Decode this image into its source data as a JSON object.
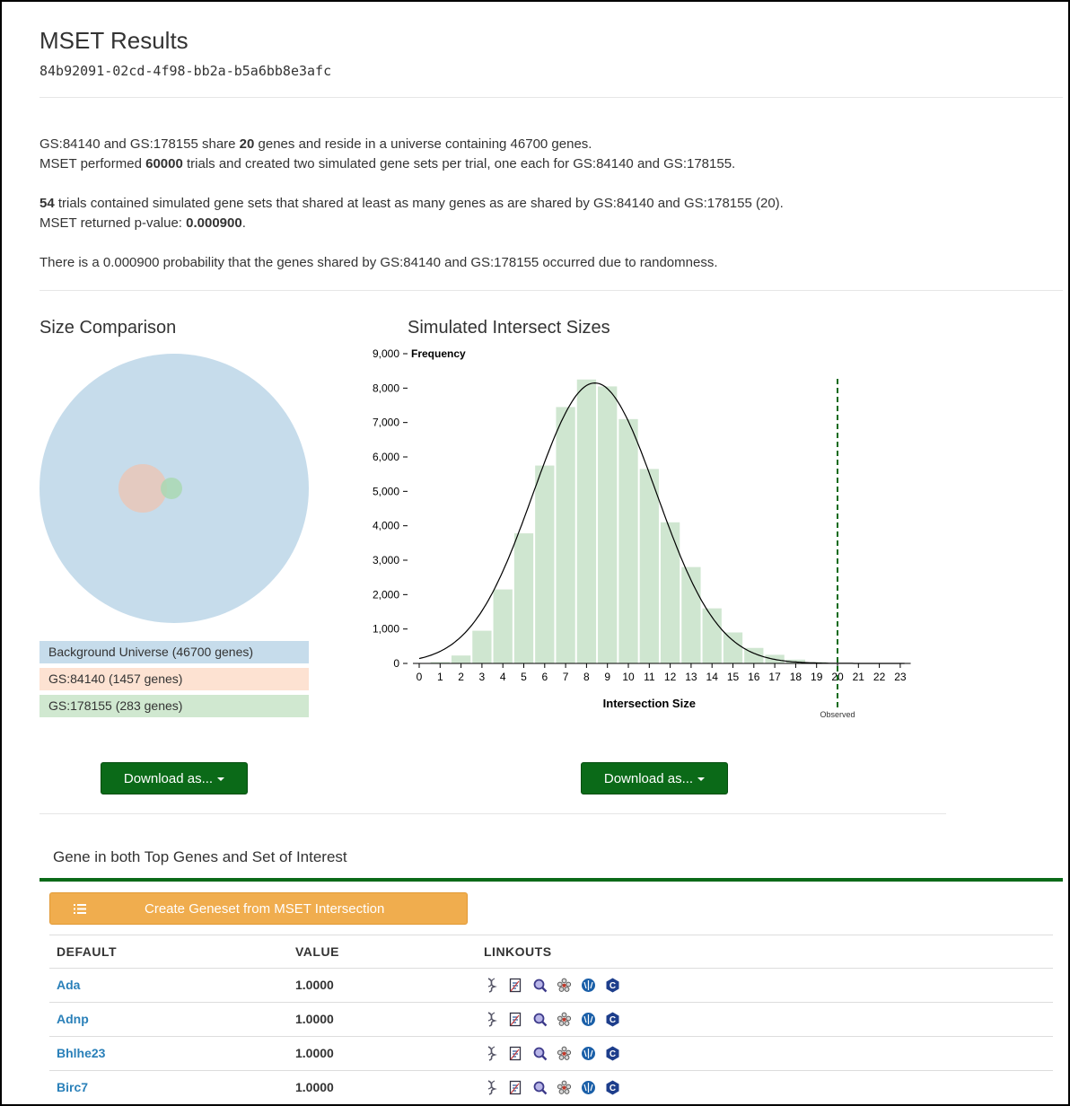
{
  "header": {
    "title": "MSET Results",
    "id": "84b92091-02cd-4f98-bb2a-b5a6bb8e3afc"
  },
  "summary": {
    "line1": {
      "a": "GS:84140 and GS:178155 share ",
      "b": "20",
      "c": " genes and reside in a universe containing 46700 genes."
    },
    "line2": {
      "a": "MSET performed ",
      "b": "60000",
      "c": " trials and created two simulated gene sets per trial, one each for GS:84140 and GS:178155."
    },
    "line3": {
      "a": "54",
      "b": " trials contained simulated gene sets that shared at least as many genes as are shared by GS:84140 and GS:178155 (20)."
    },
    "line4": {
      "a": "MSET returned p-value: ",
      "b": "0.000900",
      "c": "."
    },
    "line5": "There is a 0.000900 probability that the genes shared by GS:84140 and GS:178155 occurred due to randomness."
  },
  "size_comparison": {
    "title": "Size Comparison",
    "legend": [
      {
        "label": "Background Universe (46700 genes)",
        "color": "#c6dceb"
      },
      {
        "label": "GS:84140 (1457 genes)",
        "color": "#fde2d2"
      },
      {
        "label": "GS:178155 (283 genes)",
        "color": "#d0e8d0"
      }
    ],
    "download_label": "Download as..."
  },
  "histogram": {
    "title": "Simulated Intersect Sizes",
    "download_label": "Download as..."
  },
  "chart_data": {
    "type": "bar",
    "title": "Simulated Intersect Sizes",
    "ylabel": "Frequency",
    "xlabel": "Intersection Size",
    "x_ticks": [
      0,
      1,
      2,
      3,
      4,
      5,
      6,
      7,
      8,
      9,
      10,
      11,
      12,
      13,
      14,
      15,
      16,
      17,
      18,
      19,
      20,
      21,
      22,
      23
    ],
    "y_ticks": [
      "0",
      "1,000",
      "2,000",
      "3,000",
      "4,000",
      "5,000",
      "6,000",
      "7,000",
      "8,000",
      "9,000"
    ],
    "ylim": [
      0,
      9000
    ],
    "bar_color": "#cfe6d0",
    "series": [
      {
        "x": [
          1,
          2,
          3,
          4,
          5,
          6,
          7,
          8,
          9,
          10,
          11,
          12,
          13,
          14,
          15,
          16,
          17,
          18,
          19,
          20
        ],
        "values": [
          40,
          230,
          950,
          2150,
          3780,
          5750,
          7450,
          8250,
          8050,
          7100,
          5650,
          4100,
          2800,
          1600,
          900,
          450,
          250,
          110,
          40,
          10
        ]
      }
    ],
    "fit_curve": {
      "mean": 8.4,
      "sd": 2.95,
      "peak": 8150,
      "color": "#000000"
    },
    "observed": {
      "x": 20,
      "label": "Observed",
      "color": "#0b6a18"
    }
  },
  "genes_section": {
    "title": "Gene in both Top Genes and Set of Interest",
    "create_button": "Create Geneset from MSET Intersection",
    "columns": [
      "DEFAULT",
      "VALUE",
      "LINKOUTS"
    ],
    "rows": [
      {
        "gene": "Ada",
        "value": "1.0000"
      },
      {
        "gene": "Adnp",
        "value": "1.0000"
      },
      {
        "gene": "Bhlhe23",
        "value": "1.0000"
      },
      {
        "gene": "Birc7",
        "value": "1.0000"
      }
    ],
    "linkout_icons": [
      "dna-icon",
      "document-icon",
      "magnifier-icon",
      "flower-icon",
      "globe-icon",
      "hexagon-c-icon"
    ]
  }
}
